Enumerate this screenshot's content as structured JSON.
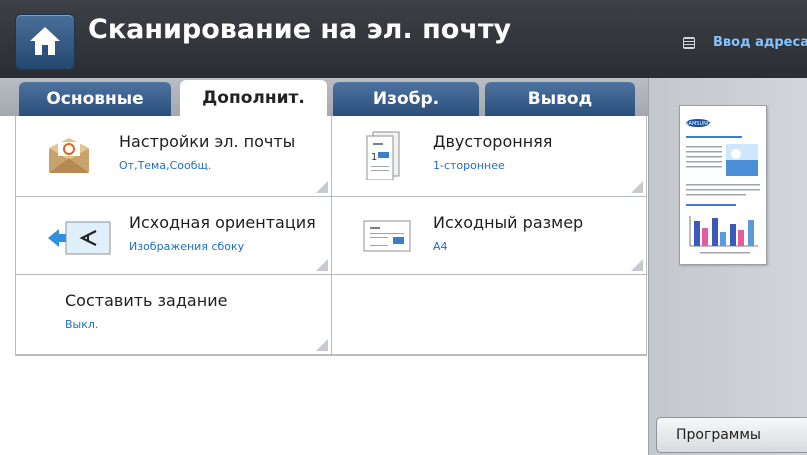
{
  "header": {
    "title": "Сканирование на эл. почту",
    "address_label": "Ввод адреса",
    "home_icon": "home-icon",
    "address_icon": "address-book-icon"
  },
  "tabs": [
    {
      "label": "Основные",
      "active": false
    },
    {
      "label": "Дополнит.",
      "active": true
    },
    {
      "label": "Изобр.",
      "active": false
    },
    {
      "label": "Вывод",
      "active": false
    }
  ],
  "options": [
    {
      "label": "Настройки эл. почты",
      "value": "От,Тема,Сообщ.",
      "icon": "email-envelope-icon"
    },
    {
      "label": "Двусторонняя",
      "value": "1-стороннее",
      "icon": "duplex-document-icon"
    },
    {
      "label": "Исходная ориентация",
      "value": "Изображения сбоку",
      "icon": "orientation-icon"
    },
    {
      "label": "Исходный размер",
      "value": "A4",
      "icon": "original-size-icon"
    },
    {
      "label": "Составить задание",
      "value": "Выкл."
    }
  ],
  "preview": {
    "logo_text": "SAMSUNG",
    "icon": "document-preview-icon"
  },
  "programs_label": "Программы",
  "colors": {
    "header_bg": "#2f3237",
    "tab_bg": "#365b87",
    "value_blue": "#1f6fc4",
    "address_blue": "#86c4ff"
  }
}
